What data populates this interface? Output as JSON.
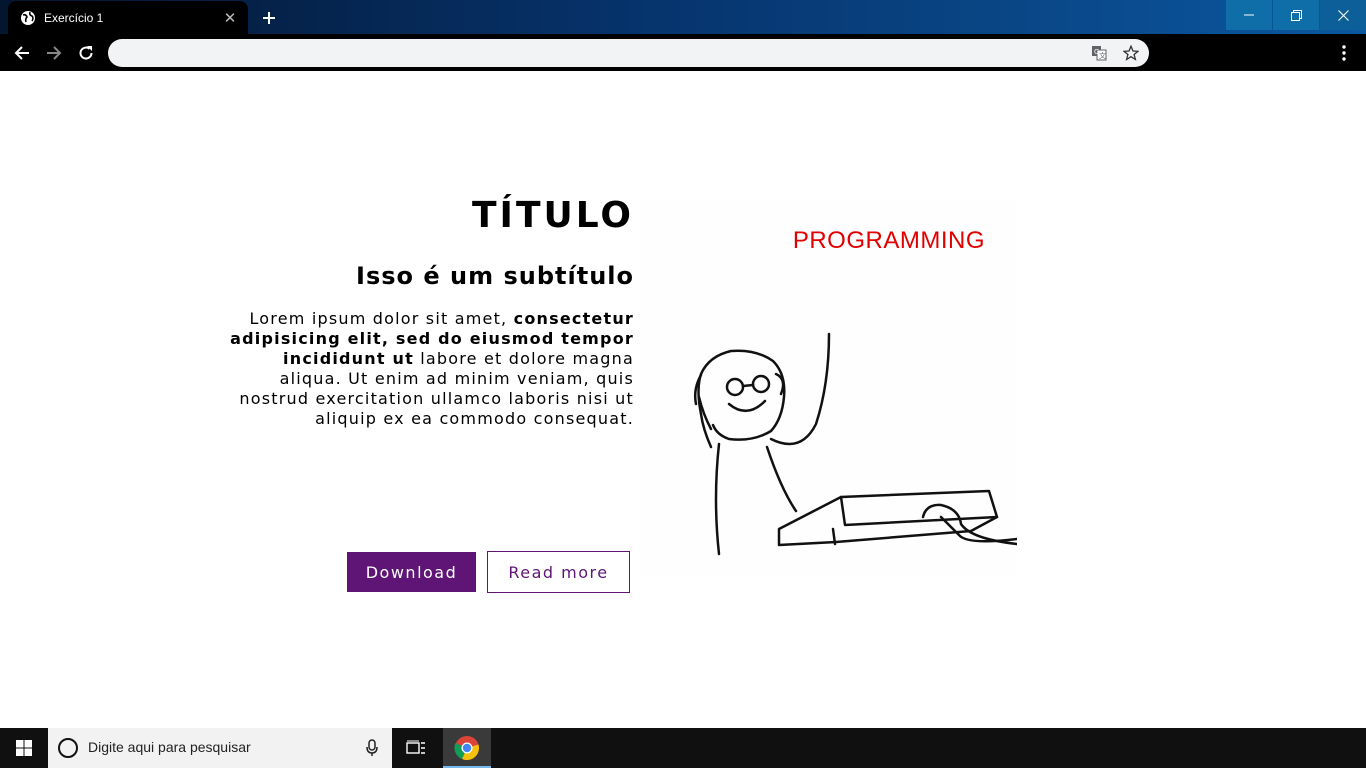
{
  "browser": {
    "tab_title": "Exercício 1",
    "address_value": "",
    "icons": {
      "favicon": "globe-icon",
      "close": "close-icon",
      "newtab": "plus-icon",
      "back": "back-arrow-icon",
      "forward": "forward-arrow-icon",
      "reload": "reload-icon",
      "translate": "translate-icon",
      "bookmark": "star-icon",
      "menu": "kebab-menu-icon"
    }
  },
  "page": {
    "title": "TÍTULO",
    "subtitle": "Isso é um subtítulo",
    "paragraph": {
      "part1": "Lorem ipsum dolor sit amet, ",
      "bold": "consectetur adipisicing elit, sed do eiusmod tempor incididunt ut",
      "part2": " labore et dolore magna aliqua. Ut enim ad minim veniam, quis nostrud exercitation ullamco laboris nisi ut aliquip ex ea commodo consequat."
    },
    "buttons": {
      "download": "Download",
      "read_more": "Read more"
    },
    "illustration_label": "PROGRAMMING",
    "colors": {
      "accent": "#5e1576",
      "illustration_label": "#e10000"
    }
  },
  "taskbar": {
    "search_placeholder": "Digite aqui para pesquisar"
  }
}
